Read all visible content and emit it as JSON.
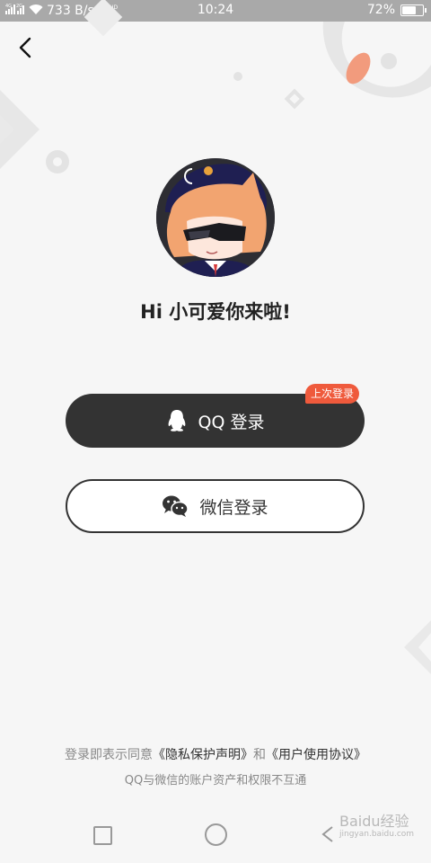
{
  "status_bar": {
    "network_label_1": "4G",
    "network_label_2": "2G",
    "speed": "733 B/s",
    "volte": "HD",
    "time": "10:24",
    "battery": "72%",
    "battery_level": 0.72
  },
  "greeting": "Hi 小可爱你来啦!",
  "qq_login": {
    "label": "QQ 登录",
    "badge": "上次登录"
  },
  "wechat_login": {
    "label": "微信登录"
  },
  "agreement": {
    "prefix": "登录即表示同意",
    "privacy_link": "《隐私保护声明》",
    "conjunction": "和",
    "terms_link": "《用户使用协议》"
  },
  "note": "QQ与微信的账户资产和权限不互通",
  "watermark": {
    "line1": "Baidu经验",
    "line2": "jingyan.baidu.com"
  },
  "colors": {
    "accent": "#ef5a3c",
    "dark_button": "#333333",
    "background": "#f6f6f6"
  }
}
